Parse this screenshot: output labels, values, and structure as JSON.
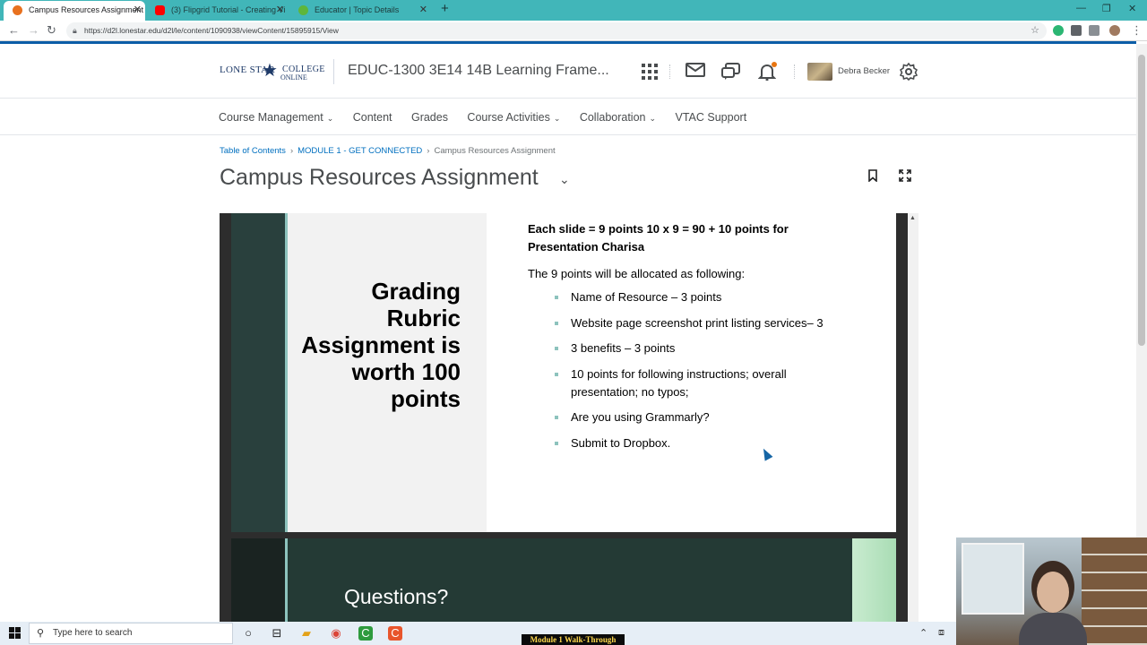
{
  "browser": {
    "tabs": [
      {
        "title": "Campus Resources Assignment",
        "active": true,
        "favicon_color": "#e8711f"
      },
      {
        "title": "(3) Flipgrid Tutorial - Creating Vi",
        "active": false,
        "favicon_color": "#ff0000"
      },
      {
        "title": "Educator | Topic Details",
        "active": false,
        "favicon_color": "#5eb63b"
      }
    ],
    "url": "https://d2l.lonestar.edu/d2l/le/content/1090938/viewContent/15895915/View"
  },
  "header": {
    "logo_line1": "LONE STAR",
    "logo_line2": "COLLEGE",
    "logo_line3": "ONLINE",
    "course_title": "EDUC-1300 3E14 14B Learning Frame...",
    "user_name": "Debra Becker"
  },
  "nav": {
    "items": [
      {
        "label": "Course Management",
        "dropdown": true
      },
      {
        "label": "Content",
        "dropdown": false
      },
      {
        "label": "Grades",
        "dropdown": false
      },
      {
        "label": "Course Activities",
        "dropdown": true
      },
      {
        "label": "Collaboration",
        "dropdown": true
      },
      {
        "label": "VTAC Support",
        "dropdown": false
      }
    ]
  },
  "breadcrumb": {
    "item1": "Table of Contents",
    "item2": "MODULE 1 - GET CONNECTED",
    "current": "Campus Resources Assignment"
  },
  "page": {
    "title": "Campus Resources Assignment"
  },
  "slide1": {
    "heading": "Grading Rubric Assignment is worth 100 points",
    "bold_line": "Each slide = 9 points  10 x 9 = 90 + 10 points for Presentation Charisa",
    "intro": "The 9 points will be allocated as following:",
    "items": [
      "Name of Resource – 3 points",
      "Website page screenshot print listing services– 3",
      "3 benefits – 3 points",
      "10 points for following instructions; overall presentation; no typos;",
      "Are you using Grammarly?",
      "Submit to Dropbox."
    ]
  },
  "slide2": {
    "heading": "Questions?"
  },
  "taskbar": {
    "search_placeholder": "Type here to search",
    "video_label": "Module 1 Walk-Through"
  }
}
